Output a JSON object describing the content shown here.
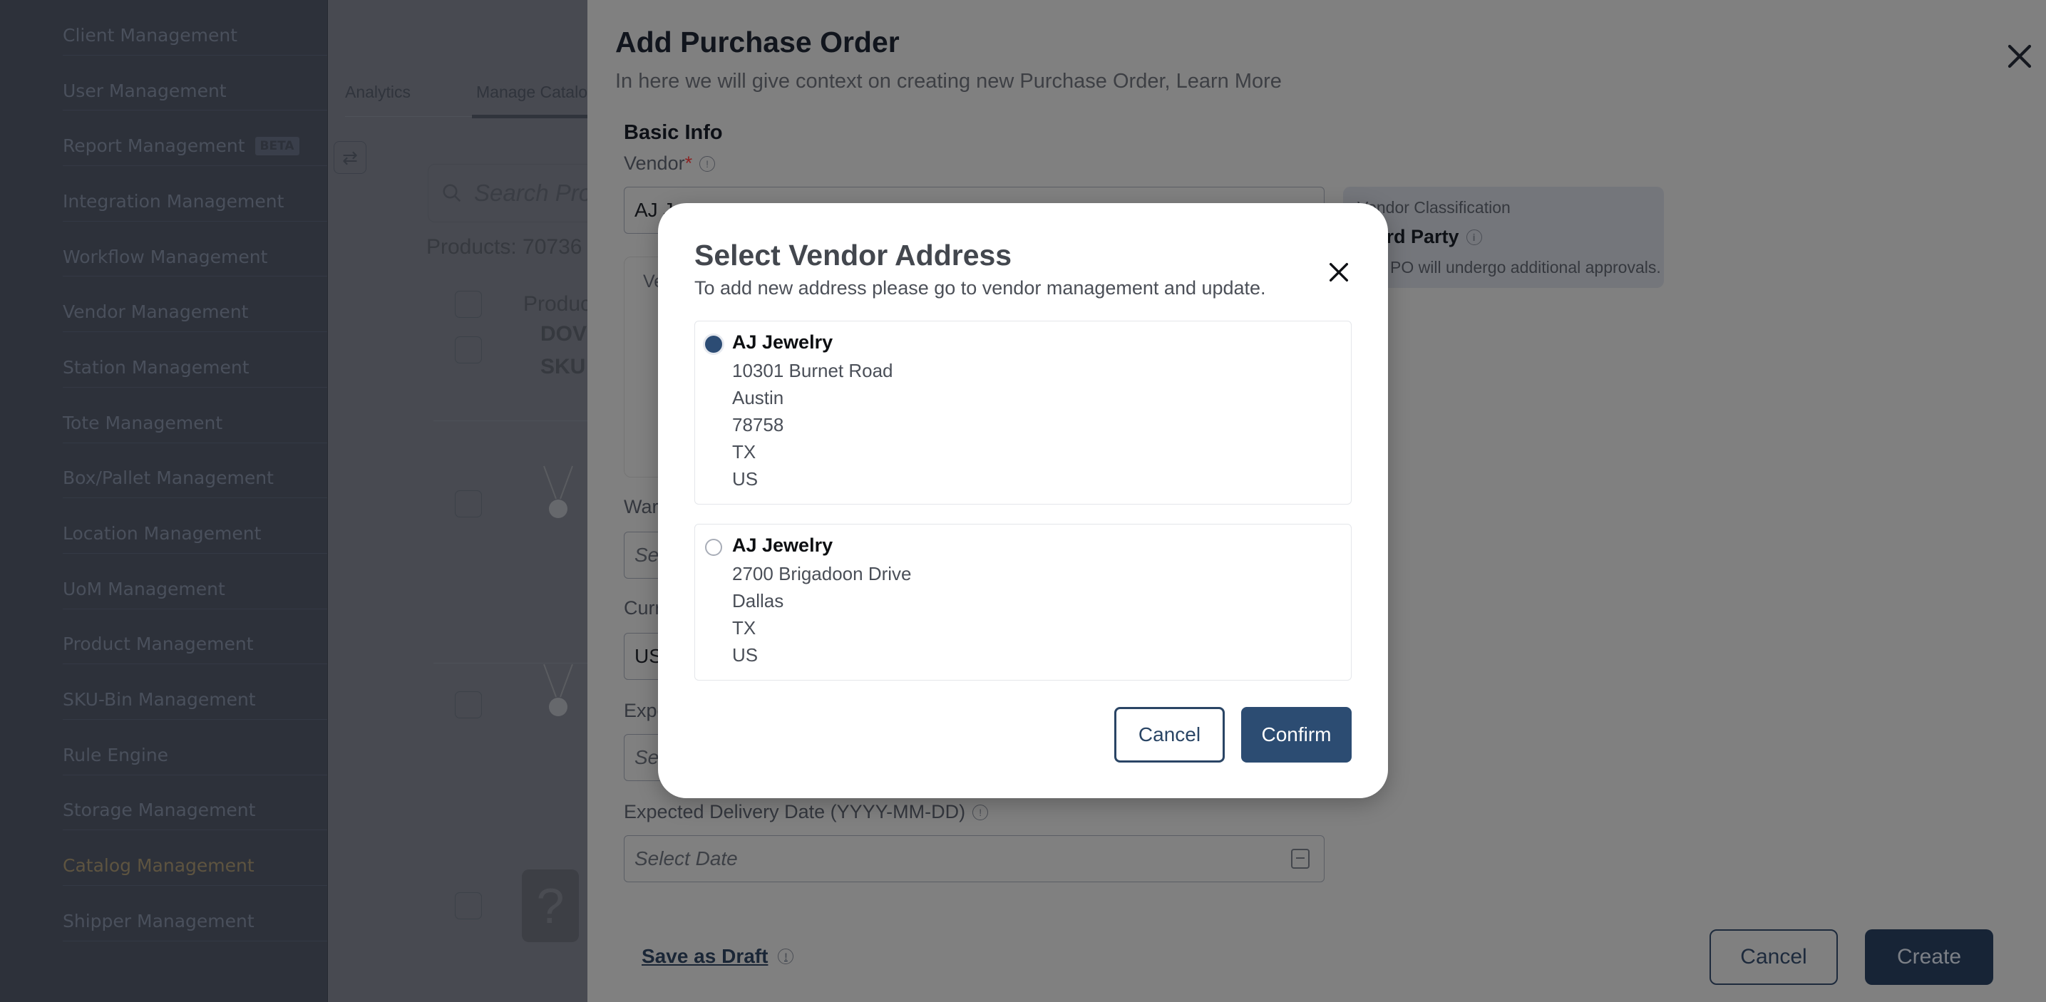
{
  "sidebar": {
    "items": [
      {
        "label": "Client Management"
      },
      {
        "label": "User Management"
      },
      {
        "label": "Report Management",
        "badge": "BETA"
      },
      {
        "label": "Integration Management"
      },
      {
        "label": "Workflow Management"
      },
      {
        "label": "Vendor Management"
      },
      {
        "label": "Station Management"
      },
      {
        "label": "Tote Management"
      },
      {
        "label": "Box/Pallet Management"
      },
      {
        "label": "Location Management"
      },
      {
        "label": "UoM Management"
      },
      {
        "label": "Product Management"
      },
      {
        "label": "SKU-Bin Management"
      },
      {
        "label": "Rule Engine"
      },
      {
        "label": "Storage Management"
      },
      {
        "label": "Catalog Management",
        "active": true
      },
      {
        "label": "Shipper Management"
      }
    ],
    "active_color": "#5e5440"
  },
  "background": {
    "tabs": [
      {
        "label": "Analytics"
      },
      {
        "label": "Manage Catalog",
        "active": true
      }
    ],
    "search_placeholder": "Search Prod",
    "products_count": "Products: 70736",
    "table_header_product": "Produc",
    "row1_name": "DOV",
    "row1_sku": "SKU:",
    "missing_image_glyph": "?"
  },
  "drawer": {
    "title": "Add Purchase Order",
    "subtitle": "In here we will give context on creating new Purchase Order, Learn More",
    "section_basic_info": "Basic Info",
    "vendor_label": "Vendor",
    "vendor_required_mark": "*",
    "vendor_value": "AJ J",
    "vendor_address_label": "Ve",
    "vendor_classification": {
      "label": "Vendor Classification",
      "value": "Third Party",
      "note": "The PO will undergo additional approvals."
    },
    "warehouse_label": "War",
    "warehouse_placeholder": "Se",
    "currency_label": "Curr",
    "currency_value": "US",
    "expected_label": "Expe",
    "expected_placeholder": "Se",
    "delivery_date_label": "Expected Delivery Date (YYYY-MM-DD)",
    "delivery_date_placeholder": "Select Date",
    "save_draft_label": "Save as Draft",
    "cancel_label": "Cancel",
    "create_label": "Create"
  },
  "modal": {
    "title": "Select Vendor Address",
    "subtitle": "To add new address please go to vendor management and update.",
    "addresses": [
      {
        "name": "AJ Jewelry",
        "lines": [
          "10301 Burnet Road",
          "Austin",
          "78758",
          "TX",
          "US"
        ],
        "selected": true
      },
      {
        "name": "AJ Jewelry",
        "lines": [
          "2700 Brigadoon Drive",
          "Dallas",
          "TX",
          "US"
        ],
        "selected": false
      }
    ],
    "cancel_label": "Cancel",
    "confirm_label": "Confirm",
    "accent_color": "#2c4c72"
  }
}
